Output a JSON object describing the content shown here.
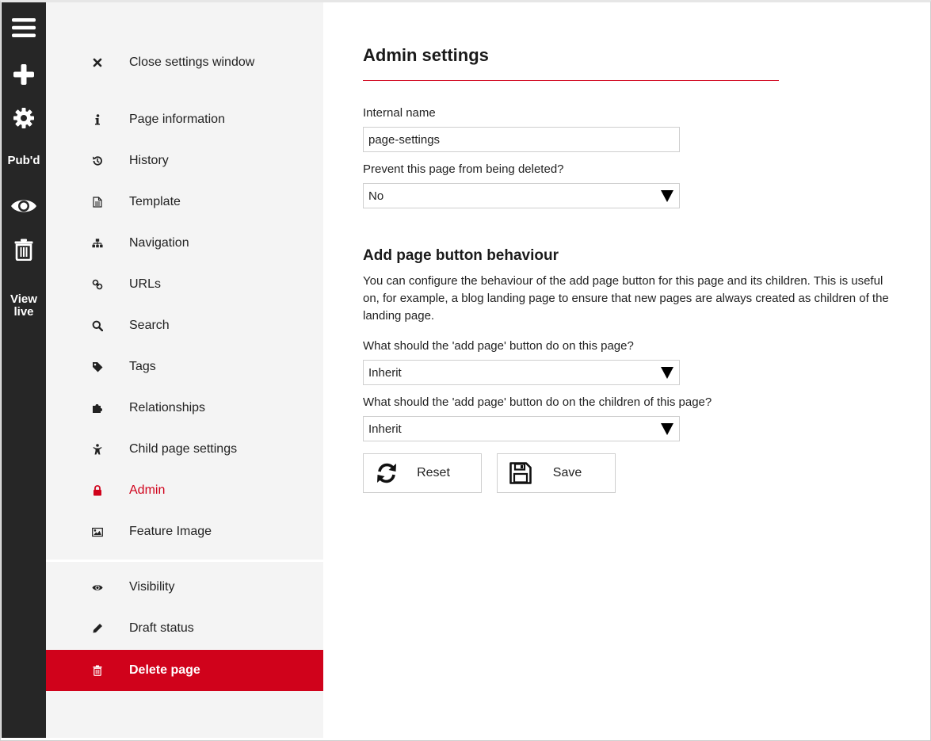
{
  "rail": {
    "menu_icon": "hamburger-icon",
    "add_icon": "plus-icon",
    "settings_icon": "gear-icon",
    "published_label": "Pub'd",
    "preview_icon": "eye-icon",
    "delete_icon": "trash-icon",
    "view_live_line1": "View",
    "view_live_line2": "live"
  },
  "nav": {
    "items": [
      {
        "label": "Close settings window",
        "icon": "close-icon"
      },
      {
        "label": "Page information",
        "icon": "info-icon"
      },
      {
        "label": "History",
        "icon": "history-icon"
      },
      {
        "label": "Template",
        "icon": "document-icon"
      },
      {
        "label": "Navigation",
        "icon": "sitemap-icon"
      },
      {
        "label": "URLs",
        "icon": "link-icon"
      },
      {
        "label": "Search",
        "icon": "search-icon"
      },
      {
        "label": "Tags",
        "icon": "tag-icon"
      },
      {
        "label": "Relationships",
        "icon": "puzzle-icon"
      },
      {
        "label": "Child page settings",
        "icon": "child-icon"
      },
      {
        "label": "Admin",
        "icon": "lock-icon"
      },
      {
        "label": "Feature Image",
        "icon": "image-icon"
      },
      {
        "label": "Visibility",
        "icon": "eye-icon"
      },
      {
        "label": "Draft status",
        "icon": "pencil-icon"
      },
      {
        "label": "Delete page",
        "icon": "trash-icon"
      }
    ],
    "active_color": "#d0021b",
    "danger_color": "#d0021b"
  },
  "main": {
    "title": "Admin settings",
    "internal_name_label": "Internal name",
    "internal_name_value": "page-settings",
    "prevent_delete_label": "Prevent this page from being deleted?",
    "prevent_delete_value": "No",
    "add_page_heading": "Add page button behaviour",
    "add_page_description": "You can configure the behaviour of the add page button for this page and its children. This is useful on, for example, a blog landing page to ensure that new pages are always created as children of the landing page.",
    "this_page_label": "What should the 'add page' button do on this page?",
    "this_page_value": "Inherit",
    "children_label": "What should the 'add page' button do on the children of this page?",
    "children_value": "Inherit",
    "reset_label": "Reset",
    "reset_icon": "refresh-icon",
    "save_label": "Save",
    "save_icon": "floppy-disk-icon"
  }
}
